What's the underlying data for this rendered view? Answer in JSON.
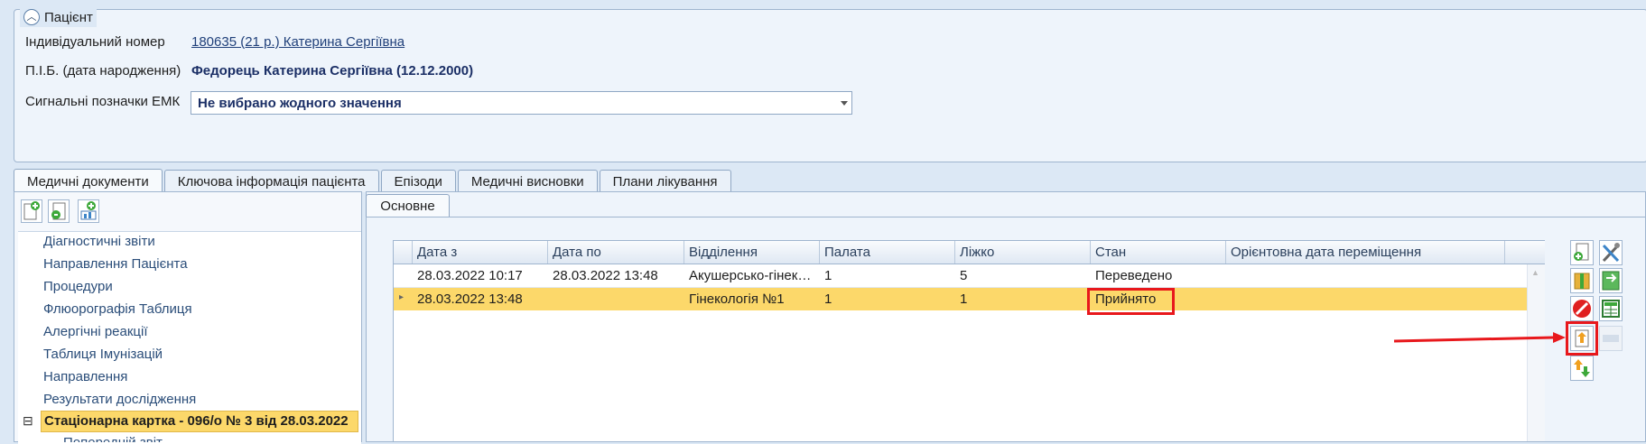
{
  "patient": {
    "section_title": "Пацієнт",
    "fields": [
      {
        "label": "Індивідуальний номер",
        "value": "180635 (21 р.) Катерина Сергіївна"
      },
      {
        "label": "П.І.Б. (дата народження)",
        "value": "Федорець Катерина Сергіївна (12.12.2000)"
      },
      {
        "label": "Сигнальні позначки ЕМК",
        "value": "Не вибрано жодного значення"
      }
    ]
  },
  "main_tabs": [
    "Медичні документи",
    "Ключова інформація пацієнта",
    "Епізоди",
    "Медичні висновки",
    "Плани лікування"
  ],
  "toolbar_icons": [
    "add-document-icon",
    "document-refresh-icon",
    "add-chart-icon"
  ],
  "tree": {
    "items": [
      "Діагностичні звіти",
      "Направлення Пацієнта",
      "Процедури",
      "Флюорографія Таблиця",
      "Алергічні реакції",
      "Таблиця Імунізацій",
      "Направлення",
      "Результати дослідження"
    ],
    "selected": "Стаціонарна картка - 096/о № 3 від 28.03.2022",
    "selected_toggle": "⊟",
    "cut_off_item": "Попередній звіт"
  },
  "sub_tab": "Основне",
  "grid": {
    "columns": [
      "Дата з",
      "Дата по",
      "Відділення",
      "Палата",
      "Ліжко",
      "Стан",
      "Орієнтовна дата переміщення"
    ],
    "rows": [
      [
        "28.03.2022 10:17",
        "28.03.2022 13:48",
        "Акушерсько-гінек…",
        "1",
        "5",
        "Переведено",
        ""
      ],
      [
        "28.03.2022 13:48",
        "",
        "Гінекологія №1",
        "1",
        "1",
        "Прийнято",
        ""
      ]
    ],
    "selected_row": 1
  },
  "side_buttons": [
    "document-add-icon",
    "tools-icon",
    "book-icon",
    "exchange-icon",
    "cancel-icon",
    "table-icon",
    "transfer-up-icon",
    "disabled-button-icon",
    "move-icon"
  ],
  "colors": {
    "selection": "#fcd86a",
    "highlight": "#e8181c",
    "accent": "#1b2f66"
  }
}
